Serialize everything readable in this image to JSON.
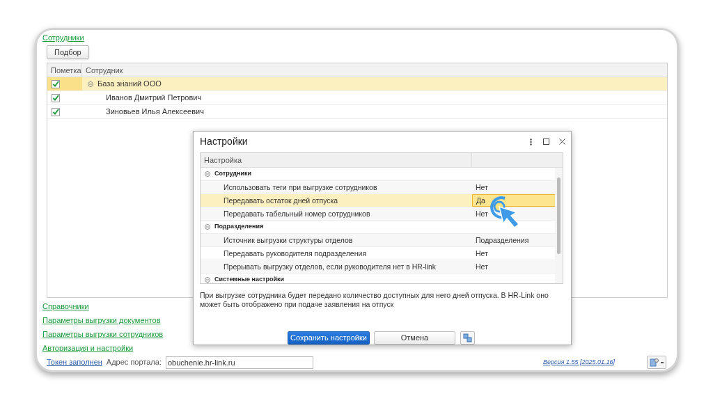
{
  "employees": {
    "link": "Сотрудники",
    "pick_button": "Подбор",
    "columns": [
      "Пометка",
      "Сотрудник"
    ],
    "rows": [
      {
        "checked": true,
        "name": "База знаний ООО",
        "selected": true,
        "expanded": true,
        "children": [
          {
            "checked": true,
            "name": "Иванов Дмитрий Петрович",
            "selected": false
          },
          {
            "checked": true,
            "name": "Зиновьев Илья Алексеевич",
            "selected": false
          }
        ]
      }
    ]
  },
  "links": [
    "Справочники",
    "Параметры выгрузки документов",
    "Параметры выгрузки сотрудников",
    "Авторизация и настройки"
  ],
  "footer": {
    "token_link": "Токен заполнен",
    "address_label": "Адрес портала:",
    "address_value": "obuchenie.hr-link.ru",
    "version_link": "Версия 1.55 [2025.01.16]"
  },
  "dialog": {
    "title": "Настройки",
    "column": "Настройка",
    "groups": [
      {
        "title": "Сотрудники",
        "expanded": true,
        "items": [
          {
            "label": "Использовать теги при выгрузке сотрудников",
            "value": "Нет",
            "selected": false
          },
          {
            "label": "Передавать остаток дней отпуска",
            "value": "Да",
            "selected": true
          },
          {
            "label": "Передавать табельный номер сотрудников",
            "value": "Нет",
            "selected": false
          }
        ]
      },
      {
        "title": "Подразделения",
        "expanded": true,
        "items": [
          {
            "label": "Источник выгрузки структуры отделов",
            "value": "Подразделения",
            "selected": false
          },
          {
            "label": "Передавать руководителя подразделения",
            "value": "Нет",
            "selected": false
          },
          {
            "label": "Прерывать выгрузку отделов, если руководителя нет в HR-link",
            "value": "Нет",
            "selected": false
          }
        ]
      },
      {
        "title": "Системные настройки",
        "expanded": true
      }
    ],
    "description": "При выгрузке сотрудника будет передано количество доступных для него дней отпуска. В HR-Link оно может быть отображено при подаче заявления на отпуск",
    "save_button": "Сохранить настройки",
    "cancel_button": "Отмена"
  }
}
